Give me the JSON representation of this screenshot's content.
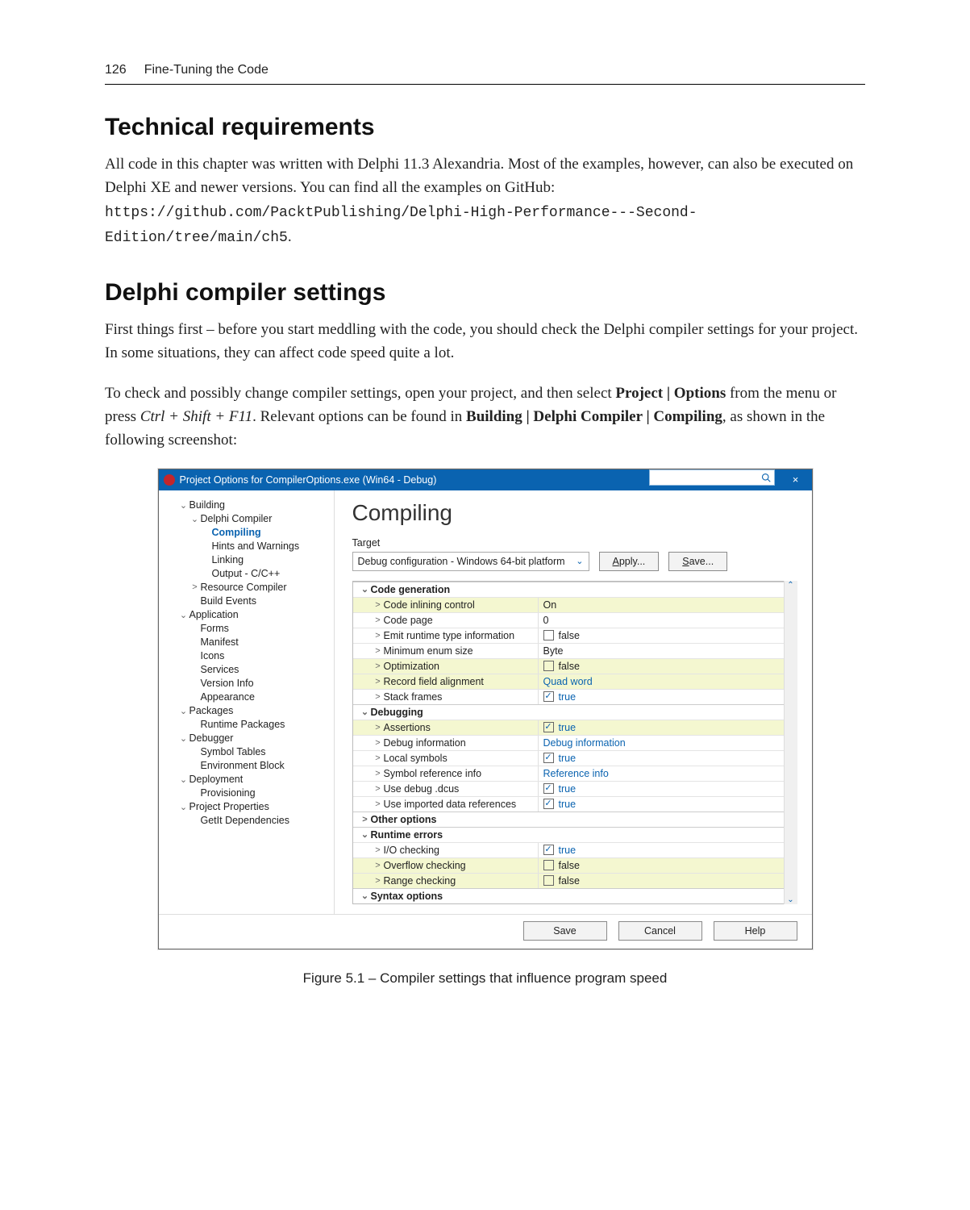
{
  "page_number": "126",
  "chapter_title": "Fine-Tuning the Code",
  "sec1_heading": "Technical requirements",
  "sec1_para_a": "All code in this chapter was written with Delphi 11.3 Alexandria. Most of the examples, however, can also be executed on Delphi XE and newer versions. You can find all the examples on GitHub: ",
  "sec1_url": "https://github.com/PacktPublishing/Delphi-High-Performance---Second-Edition/tree/main/ch5",
  "sec1_para_b": ".",
  "sec2_heading": "Delphi compiler settings",
  "sec2_p1": "First things first – before you start meddling with the code, you should check the Delphi compiler settings for your project. In some situations, they can affect code speed quite a lot.",
  "sec2_p2_a": "To check and possibly change compiler settings, open your project, and then select ",
  "sec2_p2_b": "Project | Options",
  "sec2_p2_c": " from the menu or press ",
  "sec2_p2_d": "Ctrl + Shift + F11",
  "sec2_p2_e": ". Relevant options can be found in ",
  "sec2_p2_f": "Building | Delphi Compiler | Compiling",
  "sec2_p2_g": ", as shown in the following screenshot:",
  "figure_caption": "Figure 5.1 – Compiler settings that influence program speed",
  "dlg": {
    "title": "Project Options for CompilerOptions.exe  (Win64 - Debug)",
    "close": "×",
    "right_title": "Compiling",
    "target_label": "Target",
    "target_value": "Debug configuration - Windows 64-bit platform",
    "apply_u": "A",
    "apply_rest": "pply...",
    "save_u": "S",
    "save_rest": "ave...",
    "footer_save": "Save",
    "footer_cancel": "Cancel",
    "footer_help": "Help",
    "scroll_up": "⌃",
    "scroll_down": "⌄",
    "tree": [
      {
        "level": 0,
        "caret": "v",
        "label": "Building"
      },
      {
        "level": 1,
        "caret": "v",
        "label": "Delphi Compiler"
      },
      {
        "level": 2,
        "caret": "",
        "label": "Compiling",
        "selected": true
      },
      {
        "level": 2,
        "caret": "",
        "label": "Hints and Warnings"
      },
      {
        "level": 2,
        "caret": "",
        "label": "Linking"
      },
      {
        "level": 2,
        "caret": "",
        "label": "Output - C/C++"
      },
      {
        "level": 1,
        "caret": ">",
        "label": "Resource Compiler"
      },
      {
        "level": 1,
        "caret": "",
        "label": "Build Events"
      },
      {
        "level": 0,
        "caret": "v",
        "label": "Application"
      },
      {
        "level": 1,
        "caret": "",
        "label": "Forms"
      },
      {
        "level": 1,
        "caret": "",
        "label": "Manifest"
      },
      {
        "level": 1,
        "caret": "",
        "label": "Icons"
      },
      {
        "level": 1,
        "caret": "",
        "label": "Services"
      },
      {
        "level": 1,
        "caret": "",
        "label": "Version Info"
      },
      {
        "level": 1,
        "caret": "",
        "label": "Appearance"
      },
      {
        "level": 0,
        "caret": "v",
        "label": "Packages"
      },
      {
        "level": 1,
        "caret": "",
        "label": "Runtime Packages"
      },
      {
        "level": 0,
        "caret": "v",
        "label": "Debugger"
      },
      {
        "level": 1,
        "caret": "",
        "label": "Symbol Tables"
      },
      {
        "level": 1,
        "caret": "",
        "label": "Environment Block"
      },
      {
        "level": 0,
        "caret": "v",
        "label": "Deployment"
      },
      {
        "level": 1,
        "caret": "",
        "label": "Provisioning"
      },
      {
        "level": 0,
        "caret": "v",
        "label": "Project Properties"
      },
      {
        "level": 1,
        "caret": "",
        "label": "GetIt Dependencies"
      }
    ],
    "props": [
      {
        "kind": "group",
        "caret": "v",
        "label": "Code generation"
      },
      {
        "kind": "item",
        "caret": ">",
        "label": "Code inlining control",
        "value": "On",
        "hl": true
      },
      {
        "kind": "item",
        "caret": ">",
        "label": "Code page",
        "value": "0"
      },
      {
        "kind": "item",
        "caret": ">",
        "label": "Emit runtime type information",
        "value": "false",
        "chk": "off"
      },
      {
        "kind": "item",
        "caret": ">",
        "label": "Minimum enum size",
        "value": "Byte"
      },
      {
        "kind": "item",
        "caret": ">",
        "label": "Optimization",
        "value": "false",
        "chk": "off",
        "hl": true
      },
      {
        "kind": "item",
        "caret": ">",
        "label": "Record field alignment",
        "value": "Quad word",
        "blue": true,
        "hl": true
      },
      {
        "kind": "item",
        "caret": ">",
        "label": "Stack frames",
        "value": "true",
        "chk": "on",
        "blue": true
      },
      {
        "kind": "group",
        "caret": "v",
        "label": "Debugging"
      },
      {
        "kind": "item",
        "caret": ">",
        "label": "Assertions",
        "value": "true",
        "chk": "on",
        "blue": true,
        "hl": true
      },
      {
        "kind": "item",
        "caret": ">",
        "label": "Debug information",
        "value": "Debug information",
        "blue": true
      },
      {
        "kind": "item",
        "caret": ">",
        "label": "Local symbols",
        "value": "true",
        "chk": "on",
        "blue": true
      },
      {
        "kind": "item",
        "caret": ">",
        "label": "Symbol reference info",
        "value": "Reference info",
        "blue": true
      },
      {
        "kind": "item",
        "caret": ">",
        "label": "Use debug .dcus",
        "value": "true",
        "chk": "on",
        "blue": true
      },
      {
        "kind": "item",
        "caret": ">",
        "label": "Use imported data references",
        "value": "true",
        "chk": "on",
        "blue": true
      },
      {
        "kind": "group",
        "caret": ">",
        "label": "Other options"
      },
      {
        "kind": "group",
        "caret": "v",
        "label": "Runtime errors"
      },
      {
        "kind": "item",
        "caret": ">",
        "label": "I/O checking",
        "value": "true",
        "chk": "on",
        "blue": true
      },
      {
        "kind": "item",
        "caret": ">",
        "label": "Overflow checking",
        "value": "false",
        "chk": "off",
        "hl": true
      },
      {
        "kind": "item",
        "caret": ">",
        "label": "Range checking",
        "value": "false",
        "chk": "off",
        "hl": true
      },
      {
        "kind": "group",
        "caret": "v",
        "label": "Syntax options"
      }
    ]
  }
}
